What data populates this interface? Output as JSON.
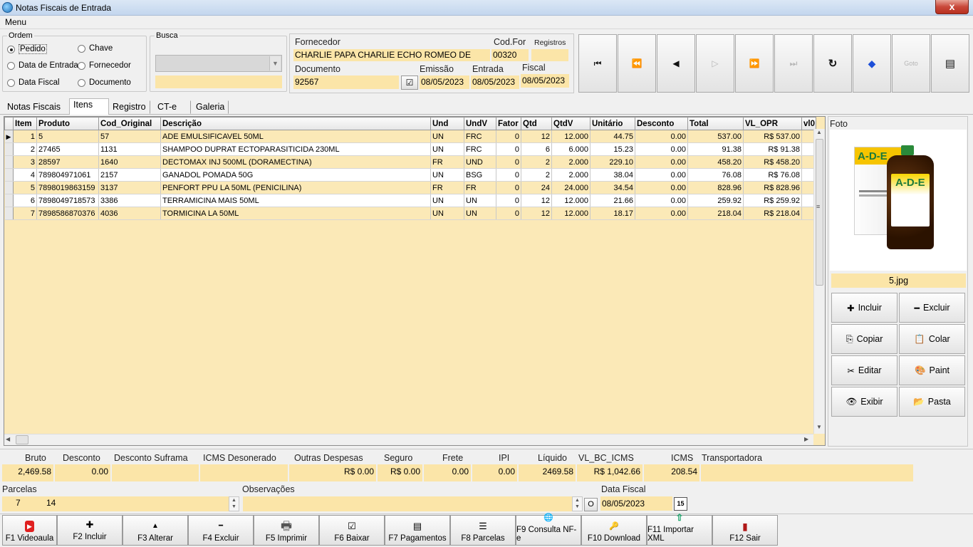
{
  "window": {
    "title": "Notas Fiscais de Entrada",
    "close_glyph": "x"
  },
  "menu": {
    "label": "Menu"
  },
  "ordem": {
    "legend": "Ordem",
    "options": [
      {
        "label": "Pedido",
        "selected": true
      },
      {
        "label": "Chave",
        "selected": false
      },
      {
        "label": "Data de Entrada",
        "selected": false
      },
      {
        "label": "Fornecedor",
        "selected": false
      },
      {
        "label": "Data Fiscal",
        "selected": false
      },
      {
        "label": "Documento",
        "selected": false
      }
    ]
  },
  "busca": {
    "legend": "Busca",
    "combo_value": "",
    "text_value": ""
  },
  "header": {
    "fornecedor_label": "Fornecedor",
    "fornecedor_value": "CHARLIE PAPA CHARLIE ECHO ROMEO DE",
    "codfor_label": "Cod.For",
    "codfor_value": "00320",
    "registros_label": "Registros",
    "registros_value": "",
    "documento_label": "Documento",
    "documento_value": "92567",
    "emissao_label": "Emissão",
    "emissao_value": "08/05/2023",
    "entrada_label": "Entrada",
    "entrada_value": "08/05/2023",
    "fiscal_label": "Fiscal",
    "fiscal_value": "08/05/2023"
  },
  "nav": {
    "buttons": [
      {
        "name": "first-record-button",
        "glyph": "⏮",
        "enabled": true
      },
      {
        "name": "prior-page-button",
        "glyph": "⏪",
        "enabled": true
      },
      {
        "name": "prior-record-button",
        "glyph": "◀",
        "enabled": true
      },
      {
        "name": "next-record-button",
        "glyph": "▷",
        "enabled": false
      },
      {
        "name": "next-page-button",
        "glyph": "⏩",
        "enabled": false
      },
      {
        "name": "last-record-button",
        "glyph": "⏭",
        "enabled": false
      },
      {
        "name": "refresh-button",
        "glyph": "↻",
        "enabled": true
      },
      {
        "name": "tag-button",
        "glyph": "◆",
        "enabled": true
      },
      {
        "name": "goto-button",
        "glyph": "Goto",
        "enabled": false
      },
      {
        "name": "form-view-button",
        "glyph": "▤",
        "enabled": true
      }
    ]
  },
  "tabs": [
    {
      "label": "Notas Fiscais",
      "active": false
    },
    {
      "label": "Itens",
      "active": true
    },
    {
      "label": "Registro",
      "active": false
    },
    {
      "label": "CT-e",
      "active": false
    },
    {
      "label": "Galeria",
      "active": false
    }
  ],
  "grid": {
    "columns": [
      "Item",
      "Produto",
      "Cod_Original",
      "Descrição",
      "Und",
      "UndV",
      "Fator",
      "Qtd",
      "QtdV",
      "Unitário",
      "Desconto",
      "Total",
      "VL_OPR",
      "vl0"
    ],
    "rows": [
      [
        "1",
        "5",
        "57",
        "ADE EMULSIFICAVEL 50ML",
        "UN",
        "FRC",
        "0",
        "12",
        "12.000",
        "44.75",
        "0.00",
        "537.00",
        "R$ 537.00",
        ""
      ],
      [
        "2",
        "27465",
        "1131",
        "SHAMPOO DUPRAT ECTOPARASITICIDA 230ML",
        "UN",
        "FRC",
        "0",
        "6",
        "6.000",
        "15.23",
        "0.00",
        "91.38",
        "R$ 91.38",
        ""
      ],
      [
        "3",
        "28597",
        "1640",
        "DECTOMAX INJ 500ML (DORAMECTINA)",
        "FR",
        "UND",
        "0",
        "2",
        "2.000",
        "229.10",
        "0.00",
        "458.20",
        "R$ 458.20",
        ""
      ],
      [
        "4",
        "789804971061",
        "2157",
        "GANADOL POMADA 50G",
        "UN",
        "BSG",
        "0",
        "2",
        "2.000",
        "38.04",
        "0.00",
        "76.08",
        "R$ 76.08",
        ""
      ],
      [
        "5",
        "7898019863159",
        "3137",
        "PENFORT PPU LA 50ML (PENICILINA)",
        "FR",
        "FR",
        "0",
        "24",
        "24.000",
        "34.54",
        "0.00",
        "828.96",
        "R$ 828.96",
        ""
      ],
      [
        "6",
        "7898049718573",
        "3386",
        "TERRAMICINA MAIS 50ML",
        "UN",
        "UN",
        "0",
        "12",
        "12.000",
        "21.66",
        "0.00",
        "259.92",
        "R$ 259.92",
        ""
      ],
      [
        "7",
        "7898586870376",
        "4036",
        "TORMICINA LA 50ML",
        "UN",
        "UN",
        "0",
        "12",
        "12.000",
        "18.17",
        "0.00",
        "218.04",
        "R$ 218.04",
        ""
      ]
    ]
  },
  "foto": {
    "label": "Foto",
    "filename": "5.jpg",
    "box_text": "A-D-E",
    "bottle_text": "A-D-E",
    "buttons": [
      {
        "name": "incluir-button",
        "label": "Incluir",
        "icon": "plus-icon",
        "glyph": "✚"
      },
      {
        "name": "excluir-button",
        "label": "Excluir",
        "icon": "minus-icon",
        "glyph": "━"
      },
      {
        "name": "copiar-button",
        "label": "Copiar",
        "icon": "copy-icon",
        "glyph": "⎘"
      },
      {
        "name": "colar-button",
        "label": "Colar",
        "icon": "paste-icon",
        "glyph": "📋"
      },
      {
        "name": "editar-button",
        "label": "Editar",
        "icon": "scissors-icon",
        "glyph": "✂"
      },
      {
        "name": "paint-button",
        "label": "Paint",
        "icon": "palette-icon",
        "glyph": "🎨"
      },
      {
        "name": "exibir-button",
        "label": "Exibir",
        "icon": "eye-icon",
        "glyph": "👁"
      },
      {
        "name": "pasta-button",
        "label": "Pasta",
        "icon": "folder-icon",
        "glyph": "📂"
      }
    ]
  },
  "totals": [
    {
      "label": "Bruto",
      "value": "2,469.58"
    },
    {
      "label": "Desconto",
      "value": "0.00"
    },
    {
      "label": "Desconto Suframa",
      "value": ""
    },
    {
      "label": "ICMS Desonerado",
      "value": ""
    },
    {
      "label": "Outras Despesas",
      "value": "R$ 0.00"
    },
    {
      "label": "Seguro",
      "value": "R$ 0.00"
    },
    {
      "label": "Frete",
      "value": "0.00"
    },
    {
      "label": "IPI",
      "value": "0.00"
    },
    {
      "label": "Líquido",
      "value": "2469.58"
    },
    {
      "label": "VL_BC_ICMS",
      "value": "R$ 1,042.66"
    },
    {
      "label": "ICMS",
      "value": "208.54"
    },
    {
      "label": "Transportadora",
      "value": ""
    }
  ],
  "parcelas": {
    "label": "Parcelas",
    "value1": "7",
    "value2": "14"
  },
  "observacoes": {
    "label": "Observações",
    "value": "",
    "o_button": "O"
  },
  "data_fiscal": {
    "label": "Data Fiscal",
    "value": "08/05/2023",
    "cal_glyph": "15"
  },
  "fkeys": [
    {
      "name": "f1-videoaula-button",
      "label": "F1 Videoaula",
      "icon": "youtube-icon",
      "glyph": "▶"
    },
    {
      "name": "f2-incluir-button",
      "label": "F2 Incluir",
      "icon": "plus-icon",
      "glyph": "✚"
    },
    {
      "name": "f3-alterar-button",
      "label": "F3 Alterar",
      "icon": "up-arrow-icon",
      "glyph": "▲"
    },
    {
      "name": "f4-excluir-button",
      "label": "F4 Excluir",
      "icon": "minus-icon",
      "glyph": "━"
    },
    {
      "name": "f5-imprimir-button",
      "label": "F5 Imprimir",
      "icon": "printer-icon",
      "glyph": "🖶"
    },
    {
      "name": "f6-baixar-button",
      "label": "F6 Baixar",
      "icon": "check-doc-icon",
      "glyph": "☑"
    },
    {
      "name": "f7-pagamentos-button",
      "label": "F7 Pagamentos",
      "icon": "form-icon",
      "glyph": "▤"
    },
    {
      "name": "f8-parcelas-button",
      "label": "F8 Parcelas",
      "icon": "list-icon",
      "glyph": "☰"
    },
    {
      "name": "f9-consulta-button",
      "label": "F9 Consulta NF-e",
      "icon": "globe-icon",
      "glyph": "🌐"
    },
    {
      "name": "f10-download-button",
      "label": "F10 Download",
      "icon": "key-icon",
      "glyph": "🔑"
    },
    {
      "name": "f11-importar-button",
      "label": "F11 Importar XML",
      "icon": "upload-icon",
      "glyph": "⇧"
    },
    {
      "name": "f12-sair-button",
      "label": "F12 Sair",
      "icon": "exit-door-icon",
      "glyph": "▮"
    }
  ],
  "colors": {
    "field_yellow": "#fbe5a8",
    "grid_odd": "#fbe9b7",
    "close_red": "#c9483a"
  }
}
